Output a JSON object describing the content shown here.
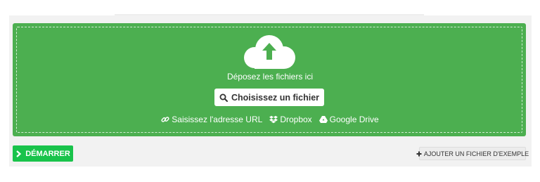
{
  "dropzone": {
    "drop_text": "Déposez les fichiers ici",
    "choose_label": "Choisissez un fichier",
    "sources": [
      {
        "label": "Saisissez l'adresse URL",
        "icon": "link-icon"
      },
      {
        "label": "Dropbox",
        "icon": "dropbox-icon"
      },
      {
        "label": "Google Drive",
        "icon": "google-drive-icon"
      }
    ],
    "icon": "cloud-upload-icon"
  },
  "actions": {
    "start_label": "DÉMARRER",
    "example_label": "AJOUTER UN FICHIER D'EXEMPLE"
  },
  "colors": {
    "dropzone_bg": "#4caf50",
    "start_bg": "#19c34b",
    "panel_bg": "#f2f2f2"
  }
}
